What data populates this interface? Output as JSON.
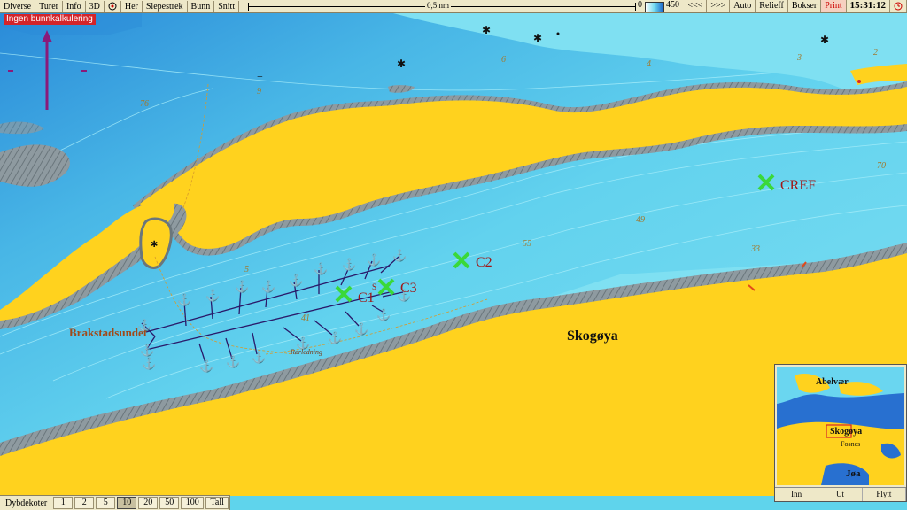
{
  "toolbar": {
    "diverse": "Diverse",
    "turer": "Turer",
    "info": "Info",
    "three_d": "3D",
    "her": "Her",
    "slepestrek": "Slepestrek",
    "bunn": "Bunn",
    "snitt": "Snitt",
    "scale_label": "0,5 nm",
    "depth_min": "0",
    "depth_max": "450",
    "zoom_out": "<<<",
    "zoom_in": ">>>",
    "auto": "Auto",
    "relieff": "Relieff",
    "bokser": "Bokser",
    "print": "Print",
    "clock": "15:31:12"
  },
  "warning": "Ingen bunnkalkulering",
  "map": {
    "place_names": {
      "skogoya": "Skogøya",
      "brakstadsundet": "Brakstadsundet",
      "rorledning": "Rørledning"
    },
    "stations": {
      "c1": "C1",
      "c2": "C2",
      "c3": "C3",
      "cref": "CREF"
    },
    "depths": {
      "d76": "76",
      "d9": "9",
      "d6": "6",
      "d4": "4",
      "d3": "3",
      "d2": "2",
      "d70": "70",
      "d49": "49",
      "d55": "55",
      "d33": "33",
      "d5": "5",
      "d41": "41",
      "d8": "8"
    },
    "marker_s": "S"
  },
  "bottombar": {
    "label": "Dybdekoter",
    "options": [
      "1",
      "2",
      "5",
      "10",
      "20",
      "50",
      "100",
      "Tall"
    ],
    "selected": "10"
  },
  "overview": {
    "labels": {
      "abelvaer": "Abelvær",
      "skogoya": "Skogøya",
      "fosnes": "Fosnes",
      "joa": "Jøa"
    },
    "buttons": {
      "inn": "Inn",
      "ut": "Ut",
      "flytt": "Flytt"
    }
  },
  "colors": {
    "land": "#ffd21e",
    "shallow": "#5fd4ec",
    "deep": "#2a8ad8",
    "shore": "#8e9aa0",
    "station": "#3ad83a",
    "station_label": "#a01818"
  }
}
